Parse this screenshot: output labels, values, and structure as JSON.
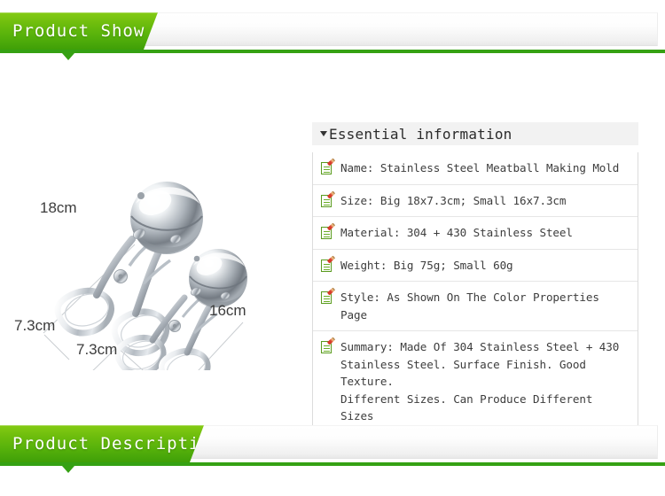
{
  "sections": {
    "top_banner": {
      "label": "Product Show",
      "tab_color_light": "#85cb14",
      "tab_color_dark": "#3f9f08",
      "rule_color": "#35a113"
    },
    "bottom_banner": {
      "label": "Product Description",
      "tab_color_light": "#85cb14",
      "tab_color_dark": "#3f9f08",
      "rule_color": "#35a113"
    }
  },
  "product_photo": {
    "alt": "Two stainless steel meatball making molds, large and small",
    "dimension_labels": [
      {
        "text": "18cm",
        "position": "upper-left"
      },
      {
        "text": "7.3cm",
        "position": "lower-left"
      },
      {
        "text": "7.3cm",
        "position": "bottom-center"
      },
      {
        "text": "16cm",
        "position": "lower-right"
      }
    ]
  },
  "spec_panel": {
    "header": "Essential information",
    "header_bg": "#f2f2f2",
    "rows": [
      {
        "icon": "note-icon",
        "text": "Name: Stainless Steel Meatball Making Mold"
      },
      {
        "icon": "note-icon",
        "text": "Size: Big 18x7.3cm; Small 16x7.3cm"
      },
      {
        "icon": "note-icon",
        "text": "Material: 304 + 430 Stainless Steel"
      },
      {
        "icon": "note-icon",
        "text": "Weight: Big 75g; Small 60g"
      },
      {
        "icon": "note-icon",
        "text": "Style: As Shown On The Color Properties Page"
      },
      {
        "icon": "note-icon",
        "text": "Summary: Made Of 304 Stainless Steel + 430\nStainless Steel. Surface Finish. Good Texture.\nDifferent Sizes. Can Produce Different Sizes\nOf Meatballs. Health And Convenient."
      }
    ]
  }
}
